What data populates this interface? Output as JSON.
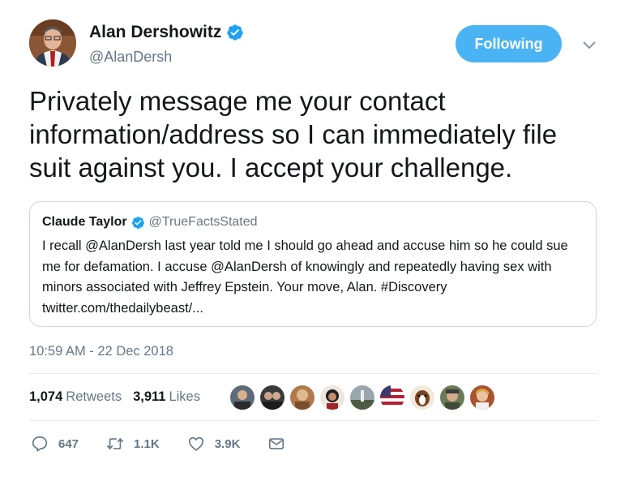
{
  "author": {
    "name": "Alan Dershowitz",
    "handle": "@AlanDersh",
    "avatar": "avatar-photo",
    "verified_icon": "verified-badge-icon"
  },
  "follow_button": {
    "label": "Following"
  },
  "menu_icon": "chevron-down-icon",
  "tweet": {
    "text": "Privately message me your contact information/address so I can immediately file suit against you. I accept your challenge."
  },
  "quoted_tweet": {
    "name": "Claude Taylor",
    "handle": "@TrueFactsStated",
    "text": "I recall @AlanDersh last year told me I should go ahead and accuse him so he could sue me for defamation. I accuse @AlanDersh of knowingly and repeatedly having sex with minors associated with Jeffrey Epstein. Your move, Alan. #Discovery twitter.com/thedailybeast/..."
  },
  "timestamp": "10:59 AM - 22 Dec 2018",
  "stats": {
    "retweets_count": "1,074",
    "retweets_label": "Retweets",
    "likes_count": "3,911",
    "likes_label": "Likes"
  },
  "likers": [
    "liker-avatar",
    "liker-avatar",
    "liker-avatar",
    "liker-avatar",
    "liker-avatar",
    "liker-avatar",
    "liker-avatar",
    "liker-avatar",
    "liker-avatar"
  ],
  "actions": {
    "reply_count": "647",
    "retweet_count": "1.1K",
    "like_count": "3.9K"
  },
  "colors": {
    "accent": "#4ab3f4",
    "verified": "#1da1f2",
    "text_primary": "#14171a",
    "text_secondary": "#657786",
    "border": "#ccd6dd"
  }
}
